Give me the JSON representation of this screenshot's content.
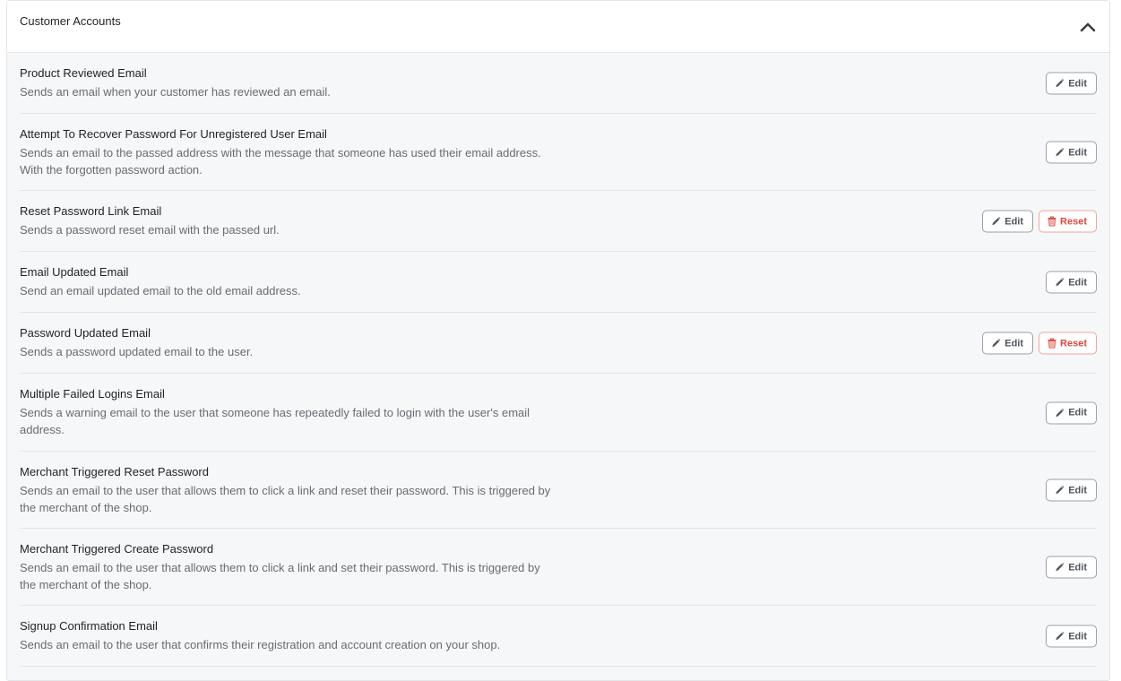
{
  "panel": {
    "title": "Customer Accounts",
    "collapse_icon": "chevron-up-icon"
  },
  "buttons": {
    "edit_label": "Edit",
    "reset_label": "Reset",
    "edit_icon": "pencil-icon",
    "reset_icon": "trash-icon"
  },
  "colors": {
    "reset_accent": "#e0483d",
    "edit_border": "#9aa0a6",
    "panel_bg": "#f6f7f9"
  },
  "templates": [
    {
      "title": "Product Reviewed Email",
      "description": [
        "Sends an email when your customer has reviewed an email."
      ],
      "has_reset": false
    },
    {
      "title": "Attempt To Recover Password For Unregistered User Email",
      "description": [
        "Sends an email to the passed address with the message that someone has used their email address.",
        "With the forgotten password action."
      ],
      "has_reset": false
    },
    {
      "title": "Reset Password Link Email",
      "description": [
        "Sends a password reset email with the passed url."
      ],
      "has_reset": true
    },
    {
      "title": "Email Updated Email",
      "description": [
        "Send an email updated email to the old email address."
      ],
      "has_reset": false
    },
    {
      "title": "Password Updated Email",
      "description": [
        "Sends a password updated email to the user."
      ],
      "has_reset": true
    },
    {
      "title": "Multiple Failed Logins Email",
      "description": [
        "Sends a warning email to the user that someone has repeatedly failed to login with the user's email",
        "address."
      ],
      "has_reset": false
    },
    {
      "title": "Merchant Triggered Reset Password",
      "description": [
        "Sends an email to the user that allows them to click a link and reset their password. This is triggered by",
        "the merchant of the shop."
      ],
      "has_reset": false
    },
    {
      "title": "Merchant Triggered Create Password",
      "description": [
        "Sends an email to the user that allows them to click a link and set their password. This is triggered by",
        "the merchant of the shop."
      ],
      "has_reset": false
    },
    {
      "title": "Signup Confirmation Email",
      "description": [
        "Sends an email to the user that confirms their registration and account creation on your shop."
      ],
      "has_reset": false
    }
  ]
}
